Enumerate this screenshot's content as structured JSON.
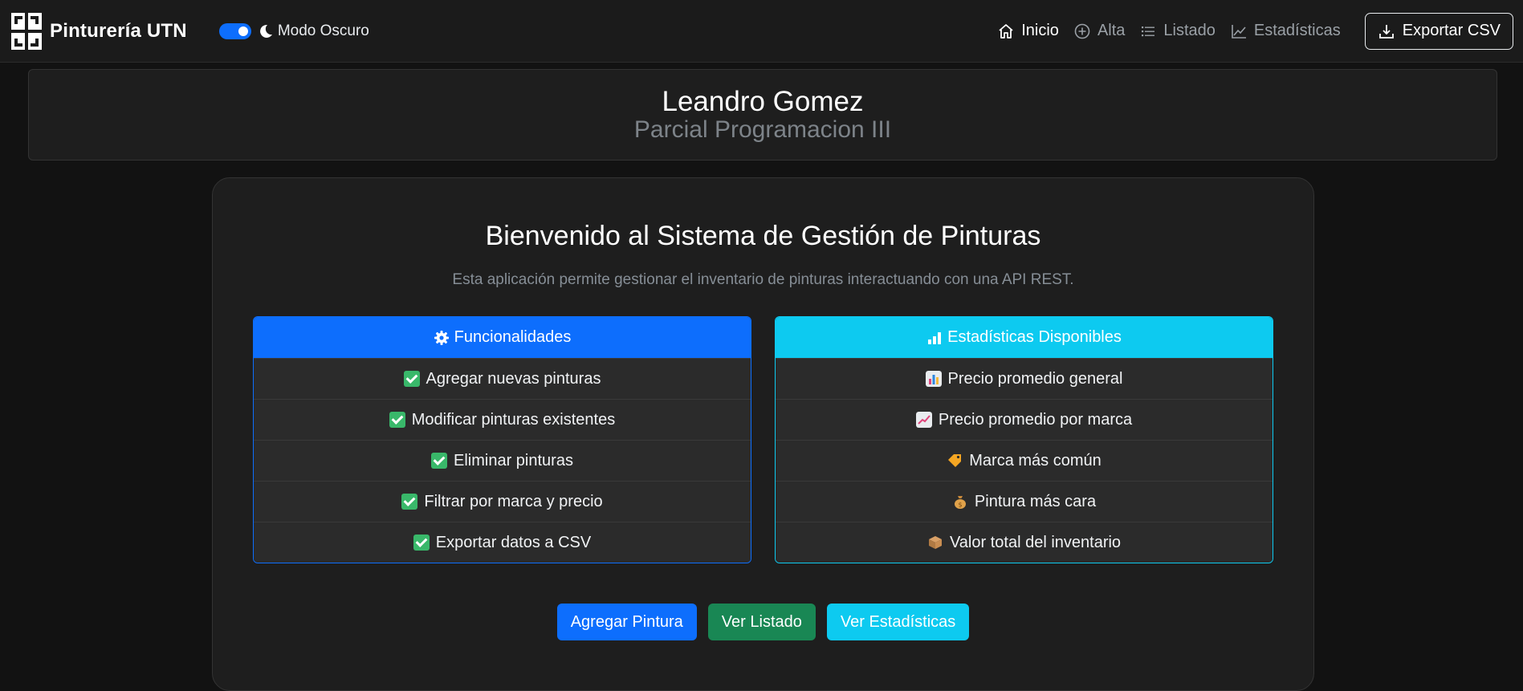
{
  "navbar": {
    "brand": "Pinturería UTN",
    "dark_mode_label": "Modo Oscuro",
    "dark_mode_on": true,
    "links": [
      {
        "label": "Inicio",
        "icon": "home-icon",
        "active": true
      },
      {
        "label": "Alta",
        "icon": "plus-circle-icon",
        "active": false
      },
      {
        "label": "Listado",
        "icon": "list-icon",
        "active": false
      },
      {
        "label": "Estadísticas",
        "icon": "graph-up-icon",
        "active": false
      }
    ],
    "export_label": "Exportar CSV"
  },
  "header": {
    "author": "Leandro Gomez",
    "course": "Parcial Programacion III"
  },
  "main": {
    "title": "Bienvenido al Sistema de Gestión de Pinturas",
    "description": "Esta aplicación permite gestionar el inventario de pinturas interactuando con una API REST.",
    "features": {
      "title": "Funcionalidades",
      "icon": "gear-icon",
      "items": [
        "Agregar nuevas pinturas",
        "Modificar pinturas existentes",
        "Eliminar pinturas",
        "Filtrar por marca y precio",
        "Exportar datos a CSV"
      ]
    },
    "stats": {
      "title": "Estadísticas Disponibles",
      "icon": "bar-chart-icon",
      "items": [
        {
          "label": "Precio promedio general",
          "icon": "bar-chart-emoji-icon"
        },
        {
          "label": "Precio promedio por marca",
          "icon": "chart-increasing-emoji-icon"
        },
        {
          "label": "Marca más común",
          "icon": "label-tag-emoji-icon"
        },
        {
          "label": "Pintura más cara",
          "icon": "money-bag-emoji-icon"
        },
        {
          "label": "Valor total del inventario",
          "icon": "package-emoji-icon"
        }
      ]
    },
    "buttons": {
      "add": "Agregar Pintura",
      "list": "Ver Listado",
      "stats": "Ver Estadísticas"
    }
  },
  "colors": {
    "primary": "#0d6efd",
    "success": "#198754",
    "info": "#0dcaf0",
    "background": "#121212",
    "card": "#1e1e1e"
  }
}
